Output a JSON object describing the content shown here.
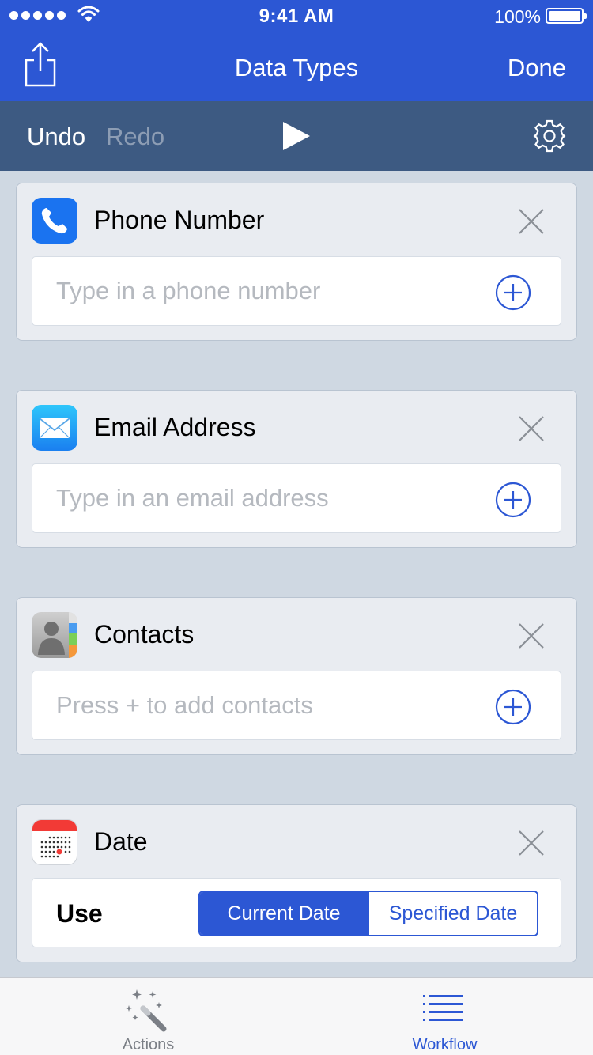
{
  "status_bar": {
    "time": "9:41 AM",
    "battery": "100%",
    "icons": [
      "signal-dots",
      "wifi-icon",
      "battery-icon"
    ]
  },
  "nav": {
    "title": "Data Types",
    "done_label": "Done",
    "share_icon": "share-icon"
  },
  "toolbar": {
    "undo_label": "Undo",
    "redo_label": "Redo",
    "play_icon": "play-icon",
    "settings_icon": "gear-icon"
  },
  "cards": [
    {
      "title": "Phone Number",
      "icon": "phone-icon",
      "placeholder": "Type in a phone number",
      "value": ""
    },
    {
      "title": "Email Address",
      "icon": "mail-icon",
      "placeholder": "Type in an email address",
      "value": ""
    },
    {
      "title": "Contacts",
      "icon": "contacts-icon",
      "placeholder": "Press + to add contacts",
      "value": ""
    }
  ],
  "date_card": {
    "title": "Date",
    "icon": "calendar-icon",
    "use_label": "Use",
    "options": [
      "Current Date",
      "Specified Date"
    ],
    "selected": "Current Date"
  },
  "tab_bar": {
    "tabs": [
      {
        "label": "Actions",
        "icon": "magic-wand-icon",
        "active": false
      },
      {
        "label": "Workflow",
        "icon": "list-icon",
        "active": true
      }
    ]
  },
  "colors": {
    "accent": "#2c57d4",
    "toolbar": "#3d5a82",
    "background": "#cfd8e2",
    "card": "#e9ecf1"
  }
}
